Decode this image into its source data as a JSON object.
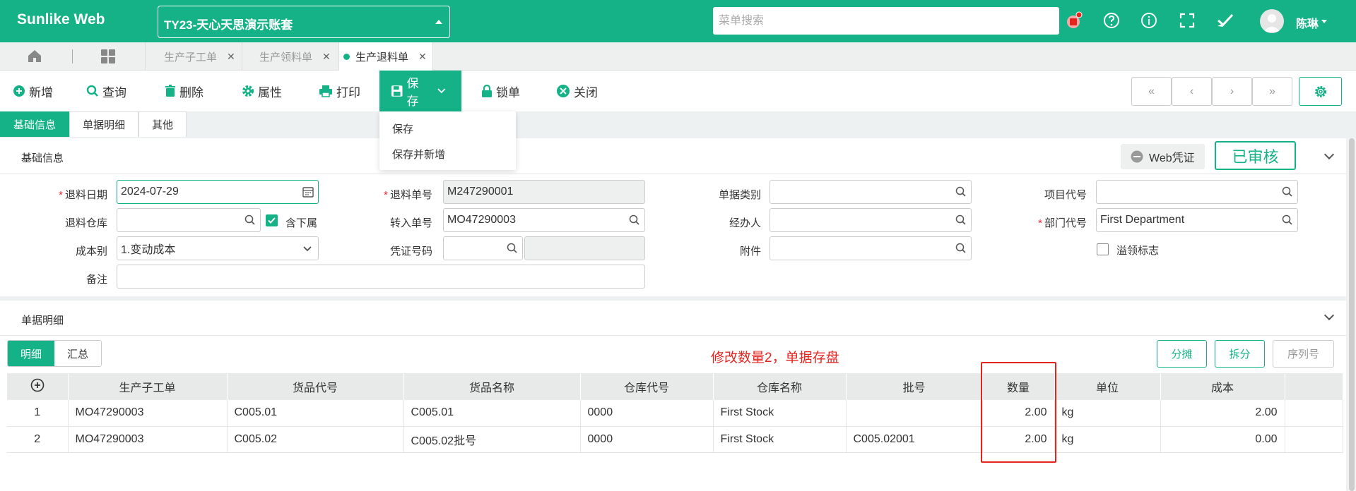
{
  "app": {
    "brand": "Sunlike Web",
    "account": "TY23-天心天思演示账套",
    "search_placeholder": "菜单搜索",
    "user": "陈琳"
  },
  "tabs": [
    {
      "label": "生产子工单"
    },
    {
      "label": "生产领料单"
    },
    {
      "label": "生产退料单",
      "active": true
    }
  ],
  "toolbar": {
    "new": "新增",
    "query": "查询",
    "delete": "删除",
    "props": "属性",
    "print": "打印",
    "save": "保存",
    "lock": "锁单",
    "close": "关闭",
    "nav": [
      "«",
      "‹",
      "›",
      "»"
    ]
  },
  "save_menu": [
    "保存",
    "保存并新增"
  ],
  "section_tabs": [
    "基础信息",
    "单据明细",
    "其他"
  ],
  "basic": {
    "title": "基础信息",
    "web_voucher": "Web凭证",
    "status": "已审核",
    "fields": {
      "return_date": {
        "label": "退料日期",
        "value": "2024-07-29"
      },
      "return_no": {
        "label": "退料单号",
        "value": "M247290001"
      },
      "doc_type": {
        "label": "单据类别",
        "value": ""
      },
      "project_code": {
        "label": "项目代号",
        "value": ""
      },
      "warehouse": {
        "label": "退料仓库",
        "value": ""
      },
      "include_sub": "含下属",
      "transfer_no": {
        "label": "转入单号",
        "value": "MO47290003"
      },
      "handler": {
        "label": "经办人",
        "value": ""
      },
      "dept": {
        "label": "部门代号",
        "value": "First Department"
      },
      "cost_type": {
        "label": "成本别",
        "value": "1.变动成本"
      },
      "voucher_no": {
        "label": "凭证号码",
        "value": ""
      },
      "attachment": {
        "label": "附件",
        "value": ""
      },
      "overflow_flag": "溢领标志",
      "remark": {
        "label": "备注",
        "value": ""
      }
    }
  },
  "detail": {
    "title": "单据明细",
    "subtabs": [
      "明细",
      "汇总"
    ],
    "annotation": "修改数量2，单据存盘",
    "actions": [
      "分摊",
      "拆分",
      "序列号"
    ],
    "columns": [
      "生产子工单",
      "货品代号",
      "货品名称",
      "仓库代号",
      "仓库名称",
      "批号",
      "数量",
      "单位",
      "成本"
    ],
    "rows": [
      {
        "idx": "1",
        "sub_order": "MO47290003",
        "item_code": "C005.01",
        "item_name": "C005.01",
        "wh_code": "0000",
        "wh_name": "First Stock",
        "batch": "",
        "qty": "2.00",
        "unit": "kg",
        "cost": "2.00"
      },
      {
        "idx": "2",
        "sub_order": "MO47290003",
        "item_code": "C005.02",
        "item_name": "C005.02批号",
        "wh_code": "0000",
        "wh_name": "First Stock",
        "batch": "C005.02001",
        "qty": "2.00",
        "unit": "kg",
        "cost": "0.00"
      }
    ]
  }
}
